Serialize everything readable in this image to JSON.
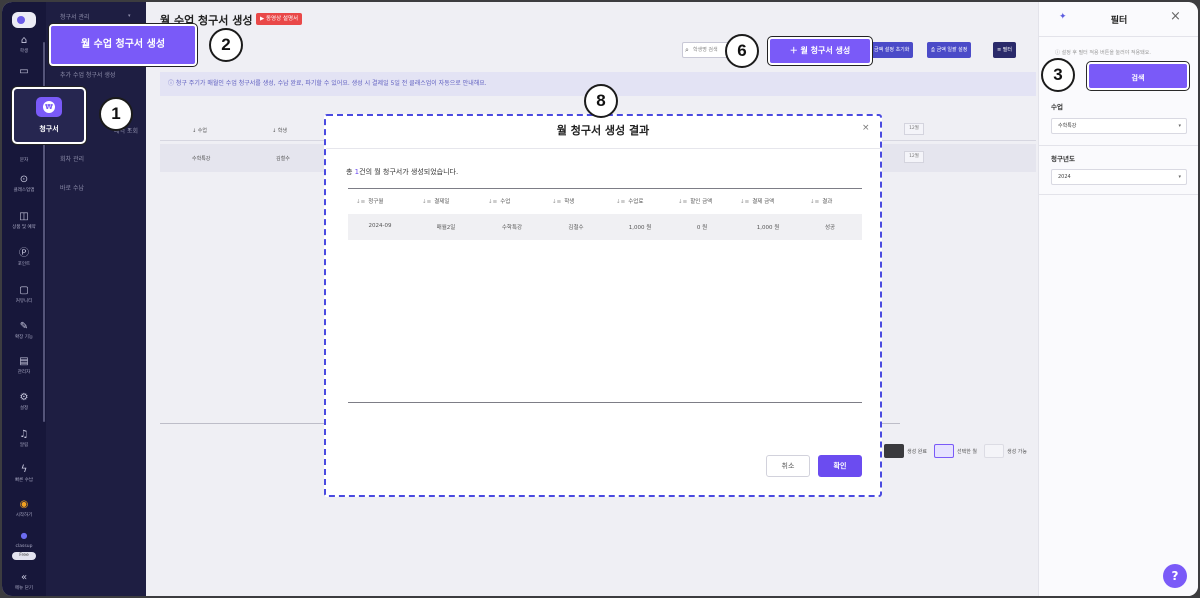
{
  "rail": {
    "items": [
      {
        "icon": "graduation-icon",
        "label": "학생"
      },
      {
        "icon": "calendar-icon",
        "label": ""
      },
      {
        "icon": "chat-icon",
        "label": "문자"
      },
      {
        "icon": "location-icon",
        "label": "클래스업앱"
      },
      {
        "icon": "bag-icon",
        "label": "상품 및 예약"
      },
      {
        "icon": "point-icon",
        "label": "포인트"
      },
      {
        "icon": "community-icon",
        "label": "커뮤니티"
      },
      {
        "icon": "extension-icon",
        "label": "확장 기능"
      },
      {
        "icon": "admin-icon",
        "label": "관리자"
      },
      {
        "icon": "settings-icon",
        "label": "설정"
      },
      {
        "icon": "bell-icon",
        "label": "알림"
      },
      {
        "icon": "lightning-icon",
        "label": "빠른 수납"
      },
      {
        "icon": "start-icon",
        "label": "시작하기"
      }
    ],
    "brand": "classup",
    "plan_badge": "Free",
    "collapse_label": "메뉴 닫기"
  },
  "submenu": {
    "items": [
      "청구서 관리",
      "추가 수업 청구서 생성",
      "회차 관리",
      "바로 수납"
    ],
    "partial_item": "내역 조회"
  },
  "invoice_tile": {
    "label": "청구서",
    "symbol": "₩"
  },
  "header": {
    "title": "월 수업 청구서 생성",
    "video_button": "동영상 설명서",
    "search_placeholder": "학생명 검색",
    "toolbar_buttons": [
      "금액 설정 초기화",
      "금액 일괄 설정",
      "필터"
    ]
  },
  "info_message": "청구 주기가 매월인 수업 청구서를 생성, 수납 완료, 파기할 수 있어요. 생성 시 결제일 5일 전 클래스업이 자동으로 안내해요.",
  "bg_table": {
    "headers": [
      "수업",
      "학생"
    ],
    "row": [
      "수학특강",
      "김철수"
    ],
    "month_cell": "12월"
  },
  "legend": [
    {
      "label": "생성 완료",
      "color": "#3a3a3e"
    },
    {
      "label": "선택한 월",
      "color": "#e6e2ff"
    },
    {
      "label": "생성 가능",
      "color": "#f4f4f8"
    }
  ],
  "callouts": {
    "c1": "1",
    "c2": "2",
    "c3": "3",
    "c6": "6",
    "c8": "8",
    "c2_label": "월 수업 청구서 생성",
    "c6_label": "월 청구서 생성"
  },
  "filter_panel": {
    "title": "필터",
    "note": "설정 후 필터 적용 버튼을 눌러야 적용돼요.",
    "search_button": "검색",
    "class_label": "수업",
    "class_value": "수학특강",
    "year_label": "청구년도",
    "year_value": "2024"
  },
  "modal": {
    "title": "월 청구서 생성 결과",
    "summary_prefix": "총 ",
    "summary_count": "1",
    "summary_suffix": "건의 월 청구서가 생성되었습니다.",
    "columns": [
      "청구월",
      "결제일",
      "수업",
      "학생",
      "수업료",
      "할인 금액",
      "결제 금액",
      "결과"
    ],
    "rows": [
      [
        "2024-09",
        "매월2일",
        "수학특강",
        "김철수",
        "1,000 원",
        "0 원",
        "1,000 원",
        "성공"
      ]
    ],
    "cancel_button": "취소",
    "confirm_button": "확인"
  },
  "colors": {
    "accent": "#7a5af8",
    "sidebar": "#17173a",
    "info": "#5f5fc0"
  }
}
